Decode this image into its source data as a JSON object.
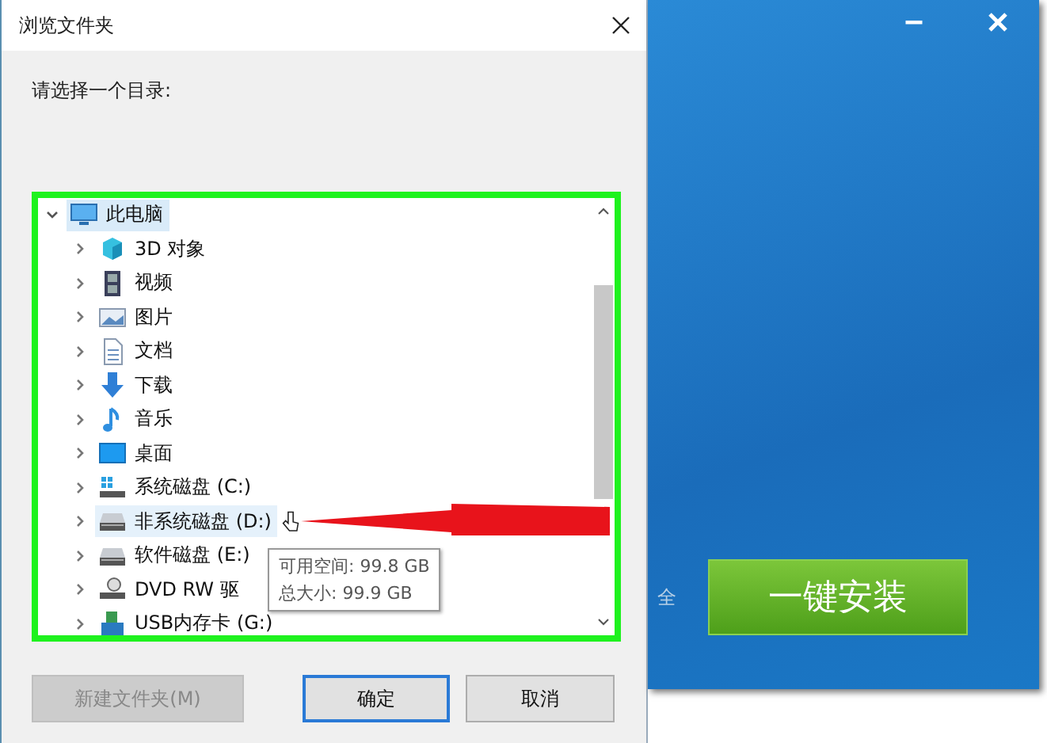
{
  "dialog": {
    "title": "浏览文件夹",
    "prompt": "请选择一个目录:",
    "tree": [
      {
        "label": "此电脑",
        "kind": "computer",
        "expanded": true,
        "selected": true,
        "hovered": false,
        "children": [
          {
            "label": "3D 对象",
            "kind": "cube",
            "expanded": false,
            "selected": false,
            "hovered": false
          },
          {
            "label": "视频",
            "kind": "video",
            "expanded": false,
            "selected": false,
            "hovered": false
          },
          {
            "label": "图片",
            "kind": "picture",
            "expanded": false,
            "selected": false,
            "hovered": false
          },
          {
            "label": "文档",
            "kind": "document",
            "expanded": false,
            "selected": false,
            "hovered": false
          },
          {
            "label": "下载",
            "kind": "download",
            "expanded": false,
            "selected": false,
            "hovered": false
          },
          {
            "label": "音乐",
            "kind": "music",
            "expanded": false,
            "selected": false,
            "hovered": false
          },
          {
            "label": "桌面",
            "kind": "desktop",
            "expanded": false,
            "selected": false,
            "hovered": false
          },
          {
            "label": "系统磁盘 (C:)",
            "kind": "system-drive",
            "expanded": false,
            "selected": false,
            "hovered": false
          },
          {
            "label": "非系统磁盘 (D:)",
            "kind": "drive",
            "expanded": false,
            "selected": false,
            "hovered": true
          },
          {
            "label": "软件磁盘 (E:)",
            "kind": "drive",
            "expanded": false,
            "selected": false,
            "hovered": false
          },
          {
            "label": "DVD RW 驱",
            "kind": "dvd",
            "expanded": false,
            "selected": false,
            "hovered": false
          },
          {
            "label": "USB内存卡 (G:)",
            "kind": "usb",
            "expanded": false,
            "selected": false,
            "hovered": false
          }
        ]
      }
    ],
    "tooltip": [
      "可用空间: 99.8 GB",
      "总大小: 99.9 GB"
    ],
    "buttons": [
      {
        "label": "新建文件夹(M)",
        "disabled": true,
        "selected": false
      },
      {
        "label": "确定",
        "disabled": false,
        "selected": true
      },
      {
        "label": "取消",
        "disabled": false,
        "selected": false
      }
    ]
  },
  "installer": {
    "partial_label": "全",
    "install_button": "一键安装"
  }
}
